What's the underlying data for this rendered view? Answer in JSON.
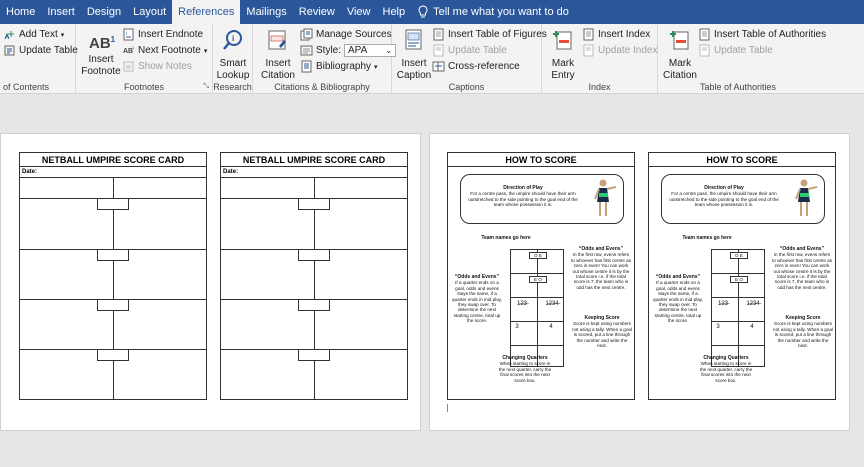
{
  "ribbon": {
    "tabs": [
      {
        "label": "Home",
        "active": false
      },
      {
        "label": "Insert",
        "active": false
      },
      {
        "label": "Design",
        "active": false
      },
      {
        "label": "Layout",
        "active": false
      },
      {
        "label": "References",
        "active": true
      },
      {
        "label": "Mailings",
        "active": false
      },
      {
        "label": "Review",
        "active": false
      },
      {
        "label": "View",
        "active": false
      },
      {
        "label": "Help",
        "active": false
      }
    ],
    "tell_me": "Tell me what you want to do",
    "groups": {
      "toc": {
        "label": "of Contents",
        "add_text": "Add Text",
        "update_table": "Update Table"
      },
      "footnotes": {
        "label": "Footnotes",
        "insert_footnote": "Insert Footnote",
        "insert_endnote": "Insert Endnote",
        "next_footnote": "Next Footnote",
        "show_notes": "Show Notes",
        "ab_glyph": "AB",
        "ab_sup": "1"
      },
      "research": {
        "label": "Research",
        "smart_lookup": "Smart Lookup"
      },
      "citations": {
        "label": "Citations & Bibliography",
        "insert_citation": "Insert Citation",
        "manage_sources": "Manage Sources",
        "style_label": "Style:",
        "style_value": "APA",
        "bibliography": "Bibliography"
      },
      "captions": {
        "label": "Captions",
        "insert_caption": "Insert Caption",
        "insert_table_of_figures": "Insert Table of Figures",
        "update_table": "Update Table",
        "cross_reference": "Cross-reference"
      },
      "index": {
        "label": "Index",
        "mark_entry": "Mark Entry",
        "insert_index": "Insert Index",
        "update_index": "Update Index"
      },
      "authorities": {
        "label": "Table of Authorities",
        "mark_citation": "Mark Citation",
        "insert_table": "Insert Table of Authorities",
        "update_table": "Update Table"
      }
    }
  },
  "document": {
    "score_card": {
      "title": "NETBALL UMPIRE SCORE CARD",
      "date_label": "Date:"
    },
    "how_to": {
      "title": "HOW TO SCORE",
      "direction_title": "Direction of Play",
      "direction_text": "For a centre pass, the umpire should have their arm outstretched to the side pointing to the goal end of the team whose possession it is.",
      "team_names": "Team names go here",
      "odds_evens_1_title": "“Odds and Evens”",
      "odds_evens_1_text": "In the first row, evens refers to whoever has first centre as zero is even! You can work out whose centre it is by the total score i.e. if the total score is 7, the team who is odd has the next centre.",
      "odds_evens_2_title": "“Odds and Evens”",
      "odds_evens_2_text": "If a quarter ends on a goal, odds and evens stays the same, if a quarter ends in mid play, they swap over. To determine the next starting centre, total up the score.",
      "keeping_title": "Keeping Score",
      "keeping_text": "Score is kept using numbers not using a tally. When a goal is scored, put a line through the number and write the next.",
      "quarters_title": "Changing Quarters",
      "quarters_text": "When starting to score in the next quarter, carry the final scores into the next score box.",
      "grid_marks": {
        "oe": "O E",
        "eo": "E O",
        "tally1": "1̶2̶3̶",
        "tally2": "1̶2̶3̶4̶",
        "n3": "3",
        "n4": "4"
      }
    }
  },
  "colors": {
    "ribbon_blue": "#2b579a",
    "ribbon_bg": "#f3f3f3",
    "doc_bg": "#e6e6e6"
  }
}
